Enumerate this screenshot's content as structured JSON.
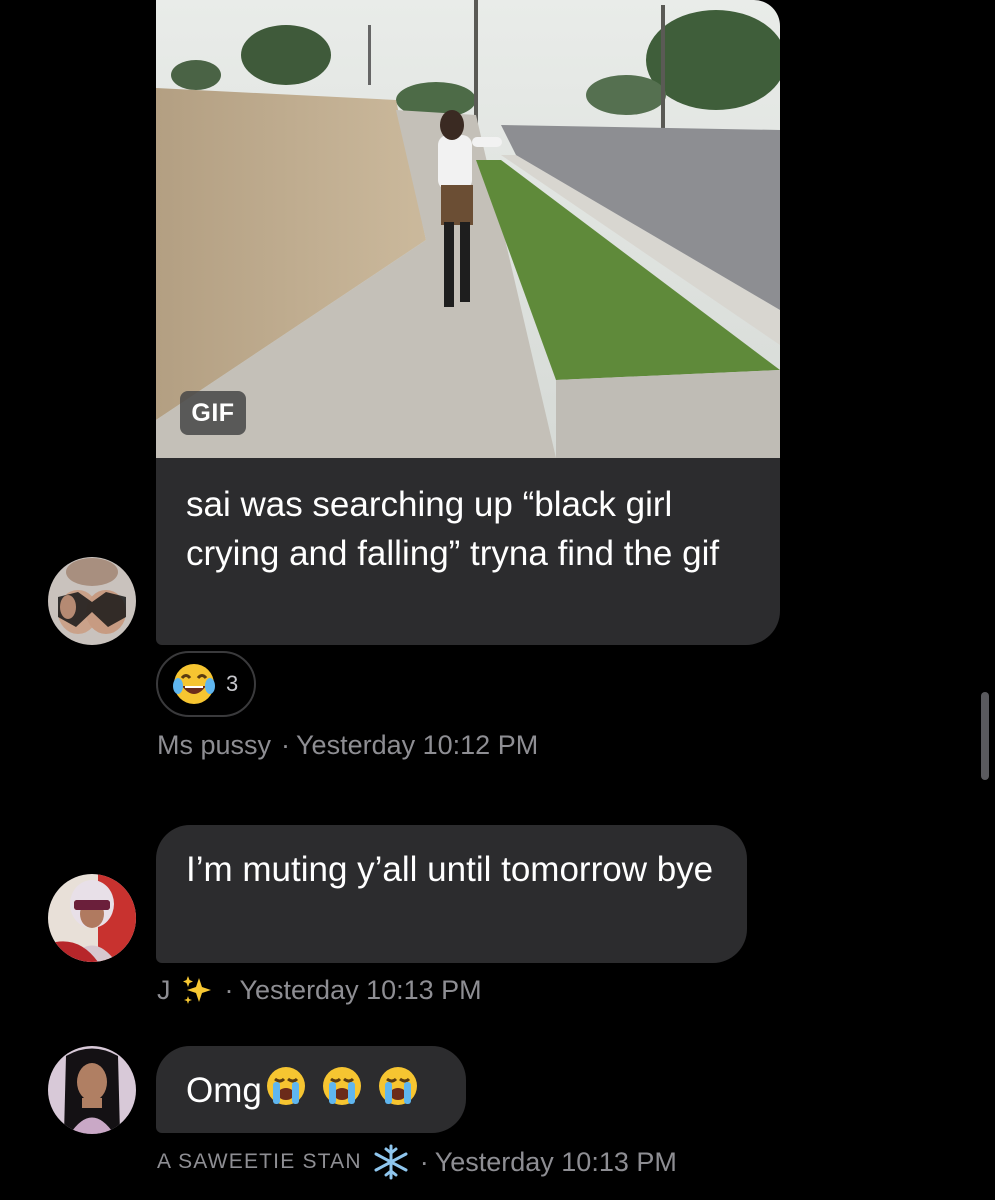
{
  "messages": [
    {
      "attachment_badge": "GIF",
      "text": "sai was searching up “black girl crying and falling” tryna find the gif",
      "reaction": {
        "emoji": "😂",
        "count": "3"
      },
      "sender": "Ms pussy",
      "separator": "·",
      "timestamp": "Yesterday 10:12 PM"
    },
    {
      "text": "I’m muting y’all until tomorrow bye",
      "sender": "J",
      "sender_emoji": "✨",
      "separator": "·",
      "timestamp": "Yesterday 10:13 PM"
    },
    {
      "text": "Omg",
      "emojis": "😭😭😭",
      "sender": "A SAWEETIE STAN",
      "sender_emoji": "❄️",
      "separator": "·",
      "timestamp": "Yesterday 10:13 PM"
    }
  ],
  "colors": {
    "background": "#000000",
    "bubble": "#2c2c2e",
    "meta_text": "#8e8e93"
  }
}
